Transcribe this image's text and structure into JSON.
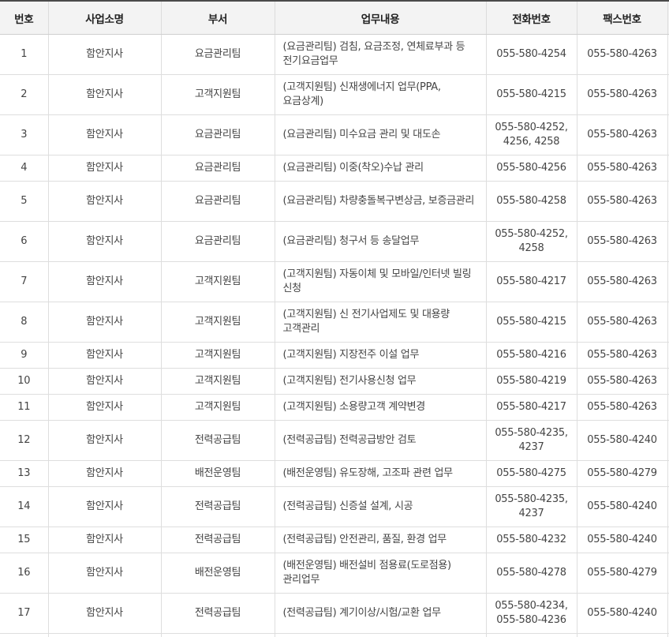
{
  "table": {
    "headers": [
      "번호",
      "사업소명",
      "부서",
      "업무내용",
      "전화번호",
      "팩스번호"
    ],
    "rows": [
      {
        "no": "1",
        "office": "함안지사",
        "dept": "요금관리팀",
        "work": "(요금관리팀) 검침, 요금조정, 연체료부과 등 전기요금업무",
        "phone": "055-580-4254",
        "fax": "055-580-4263"
      },
      {
        "no": "2",
        "office": "함안지사",
        "dept": "고객지원팀",
        "work": "(고객지원팀) 신재생에너지 업무(PPA, 요금상계)",
        "phone": "055-580-4215",
        "fax": "055-580-4263"
      },
      {
        "no": "3",
        "office": "함안지사",
        "dept": "요금관리팀",
        "work": "(요금관리팀) 미수요금 관리 및 대도손",
        "phone": "055-580-4252, 4256, 4258",
        "fax": "055-580-4263"
      },
      {
        "no": "4",
        "office": "함안지사",
        "dept": "요금관리팀",
        "work": "(요금관리팀) 이중(착오)수납 관리",
        "phone": "055-580-4256",
        "fax": "055-580-4263"
      },
      {
        "no": "5",
        "office": "함안지사",
        "dept": "요금관리팀",
        "work": "(요금관리팀) 차량충돌복구변상금, 보증금관리",
        "phone": "055-580-4258",
        "fax": "055-580-4263"
      },
      {
        "no": "6",
        "office": "함안지사",
        "dept": "요금관리팀",
        "work": "(요금관리팀) 청구서 등 송달업무",
        "phone": "055-580-4252, 4258",
        "fax": "055-580-4263"
      },
      {
        "no": "7",
        "office": "함안지사",
        "dept": "고객지원팀",
        "work": "(고객지원팀) 자동이체 및 모바일/인터넷 빌링 신청",
        "phone": "055-580-4217",
        "fax": "055-580-4263"
      },
      {
        "no": "8",
        "office": "함안지사",
        "dept": "고객지원팀",
        "work": "(고객지원팀) 신 전기사업제도 및 대용량 고객관리",
        "phone": "055-580-4215",
        "fax": "055-580-4263"
      },
      {
        "no": "9",
        "office": "함안지사",
        "dept": "고객지원팀",
        "work": "(고객지원팀) 지장전주 이설 업무",
        "phone": "055-580-4216",
        "fax": "055-580-4263"
      },
      {
        "no": "10",
        "office": "함안지사",
        "dept": "고객지원팀",
        "work": "(고객지원팀) 전기사용신청 업무",
        "phone": "055-580-4219",
        "fax": "055-580-4263"
      },
      {
        "no": "11",
        "office": "함안지사",
        "dept": "고객지원팀",
        "work": "(고객지원팀) 소용량고객 계약변경",
        "phone": "055-580-4217",
        "fax": "055-580-4263"
      },
      {
        "no": "12",
        "office": "함안지사",
        "dept": "전력공급팀",
        "work": "(전력공급팀) 전력공급방안 검토",
        "phone": "055-580-4235, 4237",
        "fax": "055-580-4240"
      },
      {
        "no": "13",
        "office": "함안지사",
        "dept": "배전운영팀",
        "work": "(배전운영팀) 유도장해, 고조파 관련 업무",
        "phone": "055-580-4275",
        "fax": "055-580-4279"
      },
      {
        "no": "14",
        "office": "함안지사",
        "dept": "전력공급팀",
        "work": "(전력공급팀) 신증설 설계, 시공",
        "phone": "055-580-4235, 4237",
        "fax": "055-580-4240"
      },
      {
        "no": "15",
        "office": "함안지사",
        "dept": "전력공급팀",
        "work": "(전력공급팀) 안전관리, 품질, 환경 업무",
        "phone": "055-580-4232",
        "fax": "055-580-4240"
      },
      {
        "no": "16",
        "office": "함안지사",
        "dept": "배전운영팀",
        "work": "(배전운영팀) 배전설비 점용료(도로점용) 관리업무",
        "phone": "055-580-4278",
        "fax": "055-580-4279"
      },
      {
        "no": "17",
        "office": "함안지사",
        "dept": "전력공급팀",
        "work": "(전력공급팀) 계기이상/시험/교환 업무",
        "phone": "055-580-4234, 055-580-4236",
        "fax": "055-580-4240"
      }
    ]
  }
}
